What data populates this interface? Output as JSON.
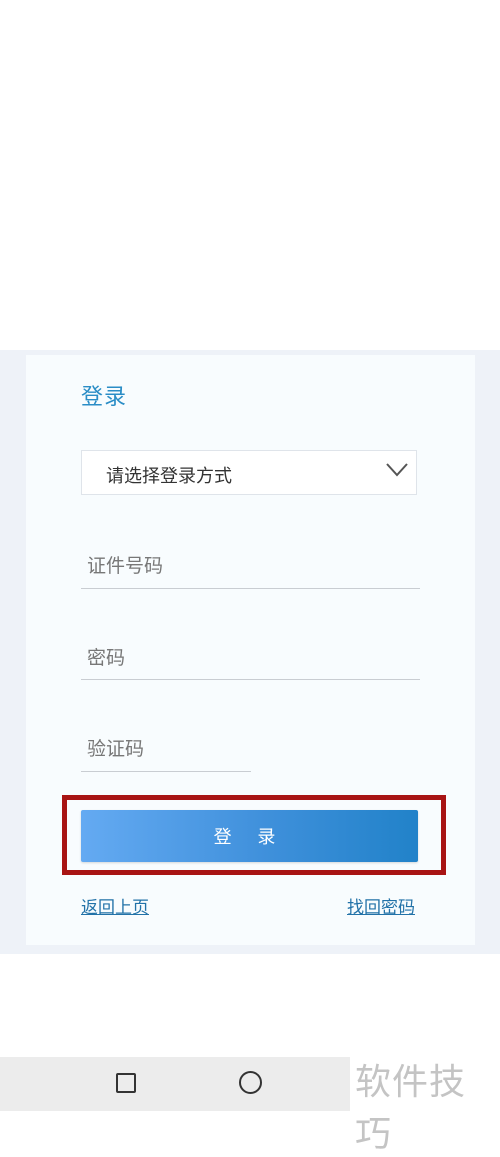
{
  "login_card": {
    "title": "登录",
    "login_method": {
      "placeholder": "请选择登录方式",
      "icon": "chevron-down-icon"
    },
    "fields": {
      "id_number": "证件号码",
      "password": "密码",
      "captcha": "验证码"
    },
    "login_button": "登 录",
    "links": {
      "back": "返回上页",
      "forgot_password": "找回密码"
    }
  },
  "colors": {
    "title": "#2a8dc6",
    "button_start": "#64aaf2",
    "button_end": "#2182c9",
    "link": "#2272a8",
    "highlight_border": "#a81414",
    "panel_background": "#eef2f8"
  },
  "system_nav": {
    "recents_icon": "square-icon",
    "home_icon": "circle-icon"
  },
  "watermark": "软件技巧"
}
